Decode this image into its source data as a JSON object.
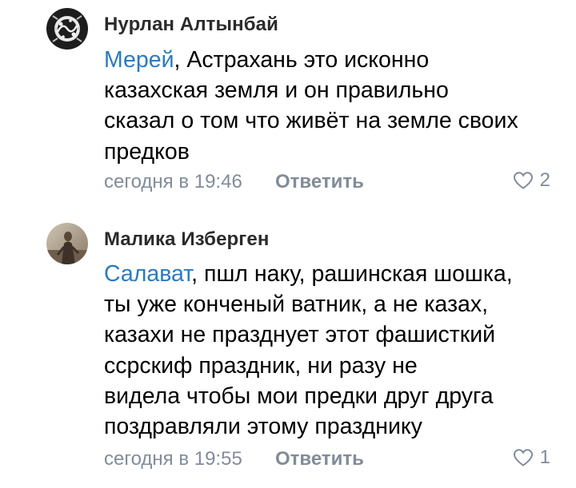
{
  "comments": [
    {
      "author": "Нурлан Алтынбай",
      "mention": "Мерей",
      "first_line_rest": ", Астрахань это исконно",
      "lines": [
        "казахская земля и он правильно",
        "сказал о том что живёт на земле своих",
        "предков"
      ],
      "timestamp": "сегодня в 19:46",
      "reply_label": "Ответить",
      "like_count": "2",
      "avatar_icon": "avatar-dark-pattern"
    },
    {
      "author": "Малика Изберген",
      "mention": "Салават",
      "first_line_rest": ", пшл наку, рашинская шошка,",
      "lines": [
        "ты уже конченый ватник, а не казах,",
        "казахи не празднует этот фашисткий",
        "ссрскиф праздник, ни разу не",
        "видела чтобы мои предки друг друга",
        "поздравляли этому празднику"
      ],
      "timestamp": "сегодня в 19:55",
      "reply_label": "Ответить",
      "like_count": "1",
      "avatar_icon": "avatar-photo"
    }
  ],
  "colors": {
    "mention": "#2a7bc0",
    "meta": "#818c99",
    "text": "#000000",
    "author": "#2b2b2b"
  }
}
